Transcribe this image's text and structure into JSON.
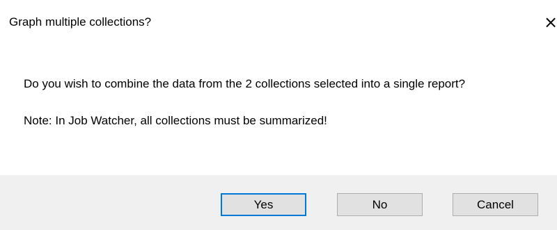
{
  "dialog": {
    "title": "Graph multiple collections?",
    "close_glyph": "×",
    "message": "Do you wish to combine the data from the 2 collections selected into a single report?",
    "note": "Note: In Job Watcher, all collections must be summarized!"
  },
  "buttons": {
    "yes": "Yes",
    "no": "No",
    "cancel": "Cancel"
  },
  "colors": {
    "footer_background": "#f0f0f0",
    "button_background": "#e1e1e1",
    "default_button_border": "#0078d7"
  },
  "icons": {
    "close": "close-icon"
  }
}
